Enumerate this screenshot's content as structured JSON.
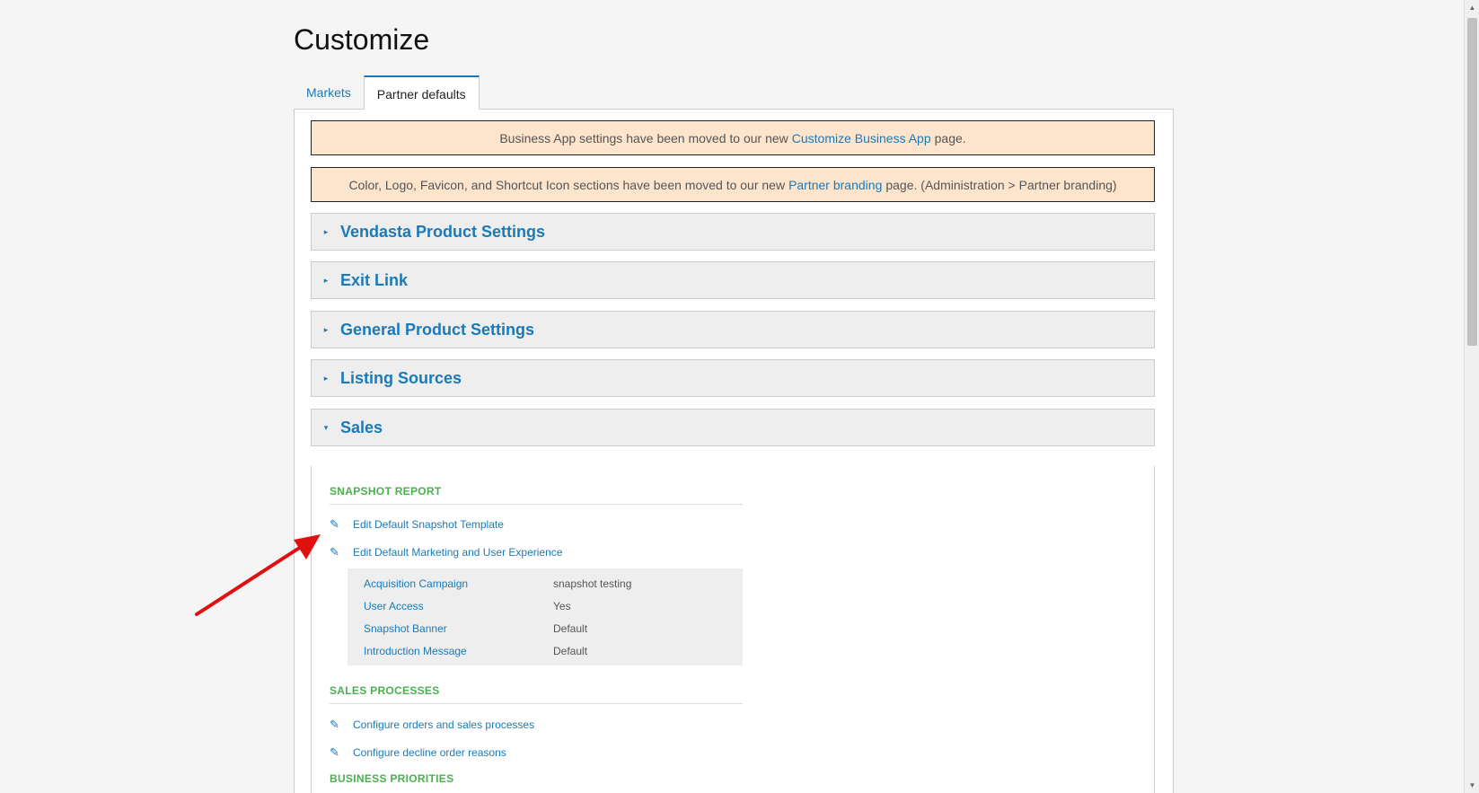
{
  "page": {
    "title": "Customize"
  },
  "tabs": [
    {
      "label": "Markets"
    },
    {
      "label": "Partner defaults"
    }
  ],
  "notices": [
    {
      "before": "Business App settings have been moved to our new",
      "link": "Customize Business App",
      "after": "page."
    },
    {
      "before": "Color, Logo, Favicon, and Shortcut Icon sections have been moved to our new",
      "link": "Partner branding",
      "after": "page. (Administration > Partner branding)"
    }
  ],
  "sections": [
    {
      "label": "Vendasta Product Settings"
    },
    {
      "label": "Exit Link"
    },
    {
      "label": "General Product Settings"
    },
    {
      "label": "Listing Sources"
    },
    {
      "label": "Sales"
    }
  ],
  "sales": {
    "snapshot_title": "SNAPSHOT REPORT",
    "snapshot_actions": [
      {
        "label": "Edit Default Snapshot Template"
      },
      {
        "label": "Edit Default Marketing and User Experience"
      }
    ],
    "snapshot_settings": [
      {
        "key": "Acquisition Campaign",
        "value": "snapshot testing"
      },
      {
        "key": "User Access",
        "value": "Yes"
      },
      {
        "key": "Snapshot Banner",
        "value": "Default"
      },
      {
        "key": "Introduction Message",
        "value": "Default"
      }
    ],
    "processes_title": "SALES PROCESSES",
    "process_actions": [
      {
        "label": "Configure orders and sales processes"
      },
      {
        "label": "Configure decline order reasons"
      }
    ],
    "priorities_title": "BUSINESS PRIORITIES"
  },
  "icons": {
    "caret_right": "▸",
    "caret_down": "▾",
    "pencil": "✎"
  },
  "colors": {
    "link": "#1a7ab8",
    "group_title": "#4caf50",
    "notice_bg": "#fde5cd",
    "annotation_arrow": "#e01010"
  }
}
